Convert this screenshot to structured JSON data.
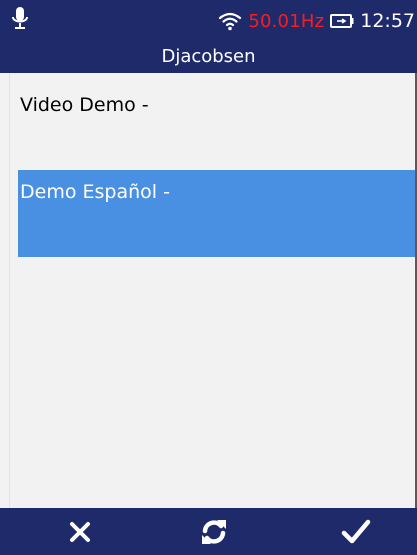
{
  "header": {
    "mic_icon": "microphone-icon",
    "wifi_icon": "wifi-icon",
    "frequency": "50.01Hz",
    "battery_icon": "battery-icon",
    "time": "12:57",
    "title": "Djacobsen",
    "colors": {
      "background": "#1f2a6b",
      "frequency": "#ff1b1b"
    }
  },
  "list": {
    "items": [
      {
        "label": "Video Demo -",
        "selected": false
      },
      {
        "label": "Demo Español -",
        "selected": true
      }
    ],
    "colors": {
      "background": "#f2f2f2",
      "selected": "#4a90e2"
    }
  },
  "footer": {
    "buttons": [
      {
        "icon": "close-icon"
      },
      {
        "icon": "refresh-icon"
      },
      {
        "icon": "checkmark-icon"
      }
    ]
  }
}
